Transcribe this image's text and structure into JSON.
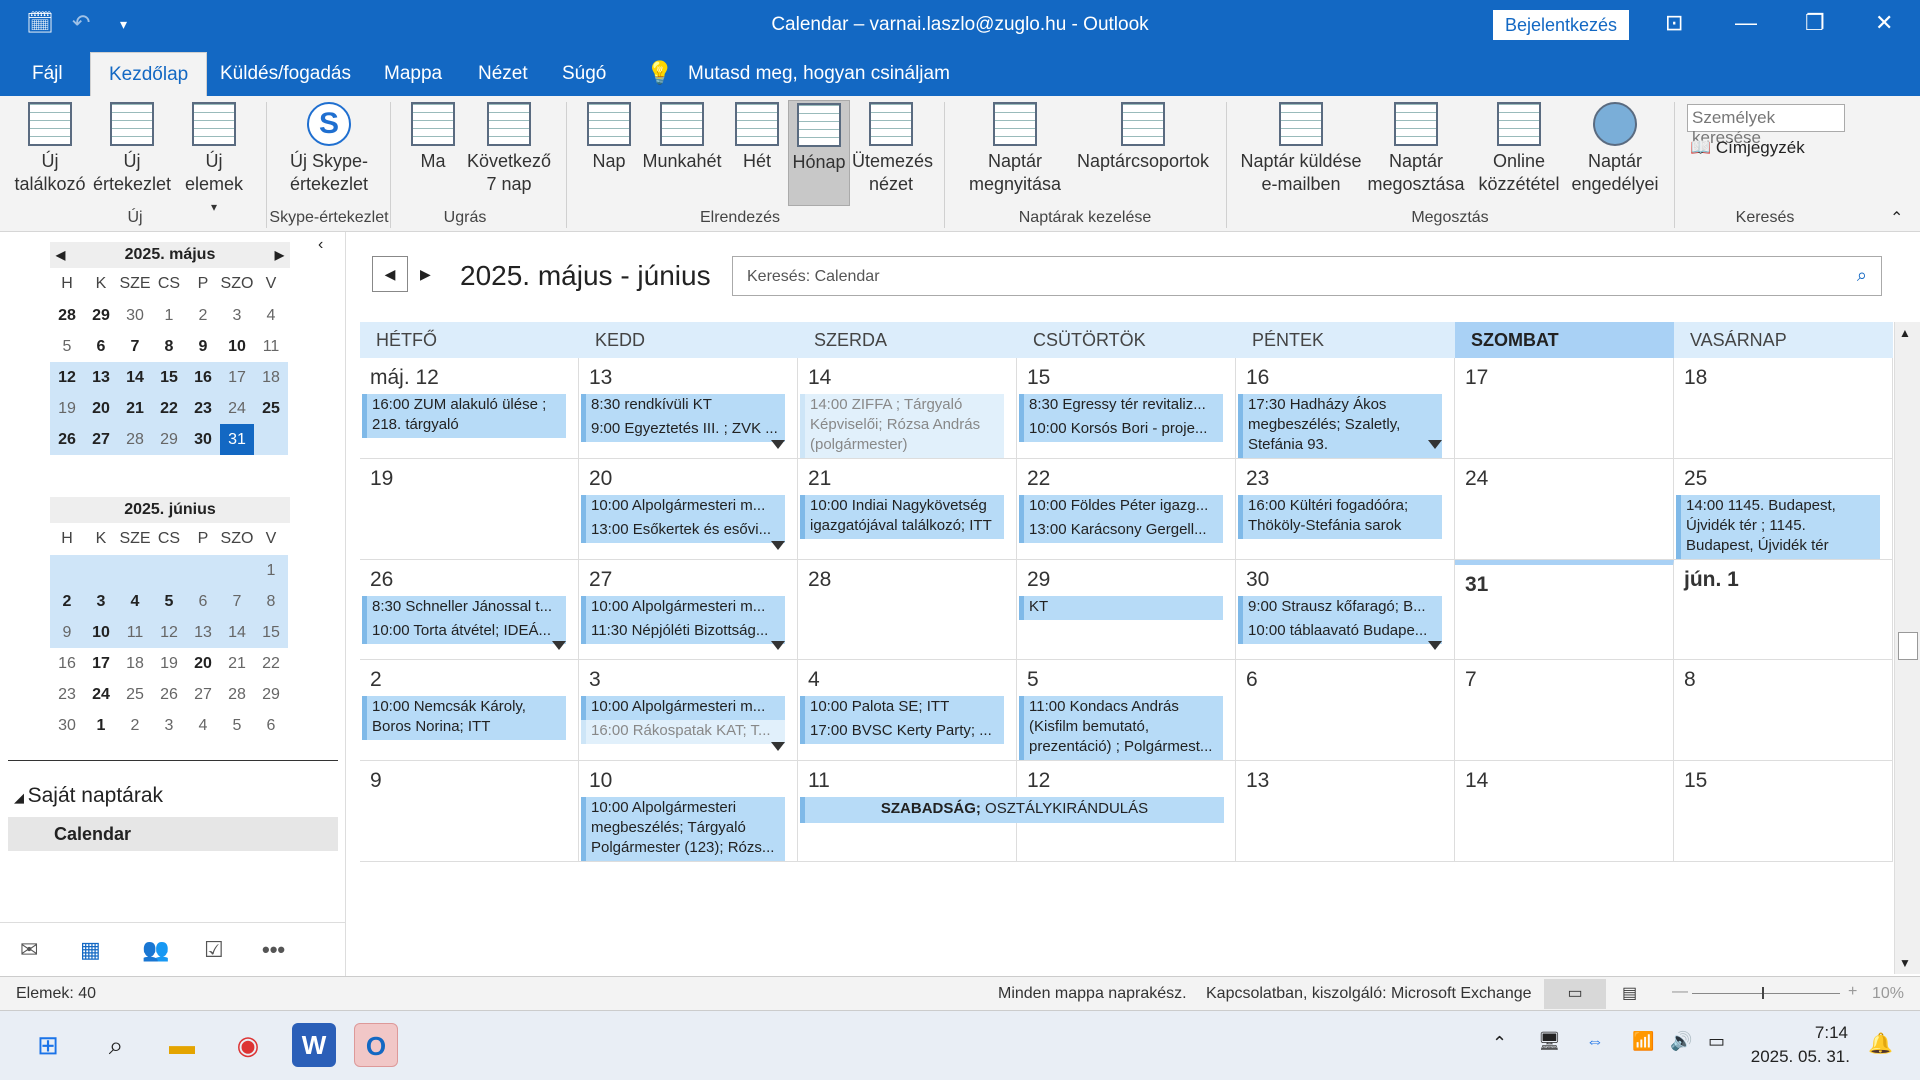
{
  "titlebar": {
    "title": "Calendar – varnai.laszlo@zuglo.hu  -  Outlook",
    "signin_label": "Bejelentkezés"
  },
  "menu": [
    "Fájl",
    "Kezdőlap",
    "Küldés/fogadás",
    "Mappa",
    "Nézet",
    "Súgó",
    "Mutasd meg, hogyan csináljam"
  ],
  "ribbon": {
    "new_appt": "Új találkozó",
    "new_meeting": "Új értekezlet",
    "new_items": "Új elemek",
    "group_new": "Új",
    "skype": "Új Skype-értekezlet",
    "group_skype": "Skype-értekezlet",
    "today": "Ma",
    "next7": "Következő 7 nap",
    "group_goto": "Ugrás",
    "day": "Nap",
    "workweek": "Munkahét",
    "week": "Hét",
    "month": "Hónap",
    "schedule": "Ütemezés nézet",
    "group_arrange": "Elrendezés",
    "open_cal": "Naptár megnyitása",
    "cal_groups": "Naptárcsoportok",
    "group_manage": "Naptárak kezelése",
    "email_cal": "Naptár küldése e-mailben",
    "share_cal": "Naptár megosztása",
    "publish_online": "Online közzététel",
    "cal_perms": "Naptár engedélyei",
    "group_share": "Megosztás",
    "people_search_placeholder": "Személyek keresése",
    "address_book": "Címjegyzék",
    "group_find": "Keresés"
  },
  "mini_may": {
    "title": "2025. május",
    "dows": [
      "H",
      "K",
      "SZE",
      "CS",
      "P",
      "SZO",
      "V"
    ],
    "weeks": [
      [
        "28",
        "29",
        "30",
        "1",
        "2",
        "3",
        "4"
      ],
      [
        "5",
        "6",
        "7",
        "8",
        "9",
        "10",
        "11"
      ],
      [
        "12",
        "13",
        "14",
        "15",
        "16",
        "17",
        "18"
      ],
      [
        "19",
        "20",
        "21",
        "22",
        "23",
        "24",
        "25"
      ],
      [
        "26",
        "27",
        "28",
        "29",
        "30",
        "31",
        ""
      ]
    ]
  },
  "mini_jun": {
    "title": "2025. június",
    "dows": [
      "H",
      "K",
      "SZE",
      "CS",
      "P",
      "SZO",
      "V"
    ],
    "weeks": [
      [
        "",
        "",
        "",
        "",
        "",
        "",
        "1"
      ],
      [
        "2",
        "3",
        "4",
        "5",
        "6",
        "7",
        "8"
      ],
      [
        "9",
        "10",
        "11",
        "12",
        "13",
        "14",
        "15"
      ],
      [
        "16",
        "17",
        "18",
        "19",
        "20",
        "21",
        "22"
      ],
      [
        "23",
        "24",
        "25",
        "26",
        "27",
        "28",
        "29"
      ],
      [
        "30",
        "1",
        "2",
        "3",
        "4",
        "5",
        "6"
      ]
    ]
  },
  "leftpane": {
    "own_calendars": "Saját naptárak",
    "calendar_name": "Calendar"
  },
  "calendar": {
    "range_title": "2025. május - június",
    "search_placeholder": "Keresés: Calendar",
    "dayheaders": [
      "HÉTFŐ",
      "KEDD",
      "SZERDA",
      "CSÜTÖRTÖK",
      "PÉNTEK",
      "SZOMBAT",
      "VASÁRNAP"
    ],
    "weeks": [
      [
        "máj. 12",
        "13",
        "14",
        "15",
        "16",
        "17",
        "18"
      ],
      [
        "19",
        "20",
        "21",
        "22",
        "23",
        "24",
        "25"
      ],
      [
        "26",
        "27",
        "28",
        "29",
        "30",
        "31",
        "jún. 1"
      ],
      [
        "2",
        "3",
        "4",
        "5",
        "6",
        "7",
        "8"
      ],
      [
        "9",
        "10",
        "11",
        "12",
        "13",
        "14",
        "15"
      ]
    ],
    "events": {
      "w0d0a": "16:00 ZUM alakuló ülése ; 218. tárgyaló",
      "w0d1a": "8:30 rendkívüli KT",
      "w0d1b": "9:00 Egyeztetés III. ; ZVK ...",
      "w0d2a": "14:00 ZIFFA ; Tárgyaló Képviselői; Rózsa András (polgármester)",
      "w0d3a": "8:30 Egressy tér revitaliz...",
      "w0d3b": "10:00 Korsós Bori - proje...",
      "w0d4a": "17:30 Hadházy Ákos megbeszélés; Szaletly, Stefánia 93.",
      "w1d1a": "10:00 Alpolgármesteri m...",
      "w1d1b": "13:00 Esőkertek és esővi...",
      "w1d2a": "10:00 Indiai Nagykövetség igazgatójával találkozó; ITT",
      "w1d3a": "10:00 Földes Péter igazg...",
      "w1d3b": "13:00 Karácsony Gergell...",
      "w1d4a": "16:00 Kültéri fogadóóra; Thököly-Stefánia sarok",
      "w1d6a": "14:00 1145. Budapest, Újvidék tér ; 1145. Budapest, Újvidék tér",
      "w2d0a": "8:30 Schneller Jánossal t...",
      "w2d0b": "10:00 Torta átvétel; IDEÁ...",
      "w2d1a": "10:00 Alpolgármesteri m...",
      "w2d1b": "11:30 Népjóléti Bizottság...",
      "w2d3a": "KT",
      "w2d4a": "9:00 Strausz kőfaragó; B...",
      "w2d4b": "10:00 táblaavató Budape...",
      "w3d0a": "10:00 Nemcsák Károly, Boros Norina; ITT",
      "w3d1a": "10:00 Alpolgármesteri m...",
      "w3d1b": "16:00 Rákospatak KAT; T...",
      "w3d2a": "10:00 Palota SE; ITT",
      "w3d2b": "17:00 BVSC Kerty Party; ...",
      "w3d3a": "11:00 Kondacs András (Kisfilm bemutató, prezentáció) ; Polgármest...",
      "w4d1a": "10:00 Alpolgármesteri megbeszélés; Tárgyaló Polgármester (123); Rózs...",
      "w4d2a_bold": "SZABADSÁG;",
      "w4d2a_rest": " OSZTÁLYKIRÁNDULÁS"
    }
  },
  "status": {
    "items": "Elemek: 40",
    "sync": "Minden mappa naprakész.",
    "connection": "Kapcsolatban, kiszolgáló: Microsoft Exchange",
    "zoom": "10%"
  },
  "taskbar": {
    "time": "7:14",
    "date": "2025. 05. 31."
  },
  "colors": {
    "brand": "#1368c3",
    "event": "#b7dbf7",
    "header": "#dcedfb"
  }
}
